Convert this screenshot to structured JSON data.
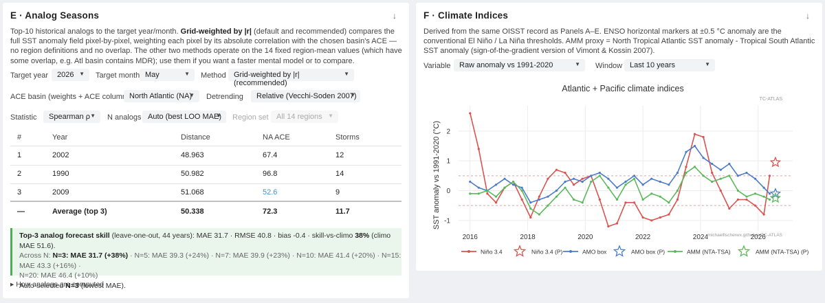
{
  "panel_e": {
    "title": "E · Analog Seasons",
    "download_icon": "↓",
    "desc": {
      "p1": "Top-10 historical analogs to the target year/month. ",
      "b1": "Grid-weighted by |r|",
      "p2": " (default and recommended) compares the full SST anomaly field pixel-by-pixel, weighting each pixel by its absolute correlation with the chosen basin's ACE — no region definitions and no overlap. The other two methods operate on the 14 fixed region-mean values (which have some overlap, e.g. Atl basin contains MDR); use them if you want a faster mental model or to compare."
    },
    "controls": {
      "target_year": {
        "label": "Target year",
        "value": "2026"
      },
      "target_month": {
        "label": "Target month",
        "value": "May"
      },
      "method": {
        "label": "Method",
        "value": "Grid-weighted by |r| (recommended)"
      },
      "ace_basin": {
        "label": "ACE basin (weights + ACE column)",
        "value": "North Atlantic (NA)"
      },
      "detrending": {
        "label": "Detrending",
        "value": "Relative (Vecchi-Soden 2007)"
      },
      "statistic": {
        "label": "Statistic",
        "value": "Spearman ρ"
      },
      "n_analogs": {
        "label": "N analogs",
        "value": "Auto (best LOO MAE)"
      },
      "region_set": {
        "label": "Region set",
        "value": "All 14 regions"
      }
    },
    "table": {
      "headers": [
        "#",
        "Year",
        "Distance",
        "NA ACE",
        "Storms"
      ],
      "rows": [
        {
          "rank": "1",
          "year": "2002",
          "distance": "48.963",
          "ace": "67.4",
          "storms": "12"
        },
        {
          "rank": "2",
          "year": "1990",
          "distance": "50.982",
          "ace": "96.8",
          "storms": "14"
        },
        {
          "rank": "3",
          "year": "2009",
          "distance": "51.068",
          "ace": "52.6",
          "storms": "9"
        }
      ],
      "average": {
        "rank": "—",
        "label": "Average (top 3)",
        "distance": "50.338",
        "ace": "72.3",
        "storms": "11.7"
      },
      "link_color": "#4a90c4"
    },
    "skill": {
      "l1_bold": "Top-3 analog forecast skill",
      "l1_a": " (leave-one-out, 44 years): MAE 31.7 · RMSE 40.8 · bias -0.4 · skill-vs-climo ",
      "l1_b": "38%",
      "l1_c": " (climo MAE 51.6).",
      "l2_a": "Across N: ",
      "l2_b": "N=3: MAE 31.7 (+38%)",
      "l2_c": " · N=5: MAE 39.3 (+24%) · N=7: MAE 39.9 (+23%) · N=10: MAE 41.4 (+20%) · N=15: MAE 43.3 (+16%) ·",
      "l3": "N=20: MAE 46.4 (+10%)",
      "l4_a": "Auto-selected ",
      "l4_b": "N=3",
      "l4_c": " (lowest MAE).",
      "accent": "#4caf50"
    },
    "footer": "▸ How analogs are computed"
  },
  "panel_f": {
    "title": "F · Climate Indices",
    "download_icon": "↓",
    "desc": "Derived from the same OISST record as Panels A–E. ENSO horizontal markers at ±0.5 °C anomaly are the conventional El Niño / La Niña thresholds. AMM proxy = North Tropical Atlantic SST anomaly - Tropical South Atlantic SST anomaly (sign-of-the-gradient version of Vimont & Kossin 2007).",
    "variable": {
      "label": "Variable",
      "value": "Raw anomaly vs 1991-2020"
    },
    "window": {
      "label": "Window",
      "value": "Last 10 years"
    },
    "watermark_top": "TC-ATLAS",
    "watermark_bottom": "michaelfischerwx.github.io/TC-ATLAS"
  },
  "chart_data": {
    "type": "line",
    "title": "Atlantic + Pacific climate indices",
    "xlabel": "",
    "ylabel": "SST anomaly vs 1991-2020 (°C)",
    "xlim": [
      2015.6,
      2027.2
    ],
    "ylim": [
      -1.35,
      2.85
    ],
    "x_ticks": [
      2016,
      2018,
      2020,
      2022,
      2024,
      2026
    ],
    "y_ticks": [
      -1,
      0,
      1,
      2
    ],
    "threshold_lines": [
      0.5,
      -0.5
    ],
    "grid": true,
    "legend_position": "bottom",
    "legend": [
      "Niño 3.4",
      "Niño 3.4 (P)",
      "AMO box",
      "AMO box (P)",
      "AMM (NTA-TSA)",
      "AMM (NTA-TSA) (P)"
    ],
    "series": [
      {
        "name": "Niño 3.4",
        "color": "#d9534f",
        "x": [
          2016.0,
          2016.3,
          2016.6,
          2016.9,
          2017.2,
          2017.5,
          2017.8,
          2018.1,
          2018.4,
          2018.7,
          2019.0,
          2019.3,
          2019.6,
          2019.9,
          2020.2,
          2020.5,
          2020.8,
          2021.1,
          2021.4,
          2021.7,
          2022.0,
          2022.3,
          2022.6,
          2022.9,
          2023.2,
          2023.5,
          2023.8,
          2024.1,
          2024.4,
          2024.7,
          2025.0,
          2025.3,
          2025.6,
          2025.9,
          2026.2,
          2026.4
        ],
        "values": [
          2.6,
          1.4,
          -0.1,
          -0.4,
          0.1,
          0.3,
          -0.3,
          -0.9,
          -0.2,
          0.4,
          0.7,
          0.6,
          0.2,
          0.4,
          0.5,
          -0.3,
          -1.2,
          -1.1,
          -0.4,
          -0.4,
          -0.9,
          -1.0,
          -0.9,
          -0.8,
          -0.3,
          0.8,
          1.9,
          1.8,
          0.6,
          0.0,
          -0.6,
          -0.3,
          -0.3,
          -0.5,
          -0.8,
          0.5
        ]
      },
      {
        "name": "AMO box",
        "color": "#4a7cc9",
        "x": [
          2016.0,
          2016.3,
          2016.6,
          2016.9,
          2017.2,
          2017.5,
          2017.8,
          2018.1,
          2018.4,
          2018.7,
          2019.0,
          2019.3,
          2019.6,
          2019.9,
          2020.2,
          2020.5,
          2020.8,
          2021.1,
          2021.4,
          2021.7,
          2022.0,
          2022.3,
          2022.6,
          2022.9,
          2023.2,
          2023.5,
          2023.8,
          2024.1,
          2024.4,
          2024.7,
          2025.0,
          2025.3,
          2025.6,
          2025.9,
          2026.2,
          2026.4
        ],
        "values": [
          0.3,
          0.1,
          0.0,
          0.2,
          0.4,
          0.2,
          0.1,
          -0.4,
          -0.3,
          -0.2,
          0.0,
          0.3,
          0.4,
          0.3,
          0.5,
          0.6,
          0.4,
          0.1,
          0.3,
          0.5,
          0.2,
          0.4,
          0.3,
          0.2,
          0.6,
          1.3,
          1.5,
          1.1,
          0.9,
          0.7,
          0.9,
          0.5,
          0.6,
          0.4,
          0.1,
          -0.1
        ]
      },
      {
        "name": "AMM (NTA-TSA)",
        "color": "#5cb85c",
        "x": [
          2016.0,
          2016.3,
          2016.6,
          2016.9,
          2017.2,
          2017.5,
          2017.8,
          2018.1,
          2018.4,
          2018.7,
          2019.0,
          2019.3,
          2019.6,
          2019.9,
          2020.2,
          2020.5,
          2020.8,
          2021.1,
          2021.4,
          2021.7,
          2022.0,
          2022.3,
          2022.6,
          2022.9,
          2023.2,
          2023.5,
          2023.8,
          2024.1,
          2024.4,
          2024.7,
          2025.0,
          2025.3,
          2025.6,
          2025.9,
          2026.2,
          2026.4
        ],
        "values": [
          -0.1,
          -0.1,
          0.0,
          -0.2,
          0.1,
          0.3,
          0.0,
          -0.6,
          -0.8,
          -0.5,
          -0.2,
          0.1,
          -0.3,
          -0.4,
          0.3,
          0.5,
          0.1,
          -0.3,
          0.2,
          0.4,
          -0.3,
          -0.1,
          -0.2,
          -0.4,
          0.0,
          0.6,
          0.8,
          0.5,
          0.3,
          0.4,
          0.5,
          0.0,
          -0.2,
          -0.1,
          -0.2,
          -0.3
        ]
      }
    ],
    "projections": [
      {
        "name": "Niño 3.4 (P)",
        "color": "#d9534f",
        "x": 2026.6,
        "value": 0.95
      },
      {
        "name": "AMO box (P)",
        "color": "#4a7cc9",
        "x": 2026.6,
        "value": -0.1
      },
      {
        "name": "AMM (NTA-TSA) (P)",
        "color": "#5cb85c",
        "x": 2026.6,
        "value": -0.25
      }
    ]
  }
}
